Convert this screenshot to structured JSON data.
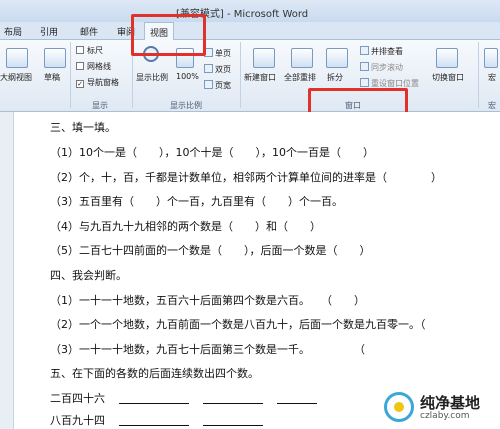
{
  "window": {
    "title": "[兼容模式] - Microsoft Word"
  },
  "tabs": [
    "布局",
    "引用",
    "邮件",
    "审阅",
    "视图"
  ],
  "active_tab": "视图",
  "ribbon": {
    "views": {
      "outline": "大纲视图",
      "draft": "草稿"
    },
    "show": {
      "ruler": "标尺",
      "gridlines": "网格线",
      "nav_pane": "导航窗格",
      "nav_pane_checked": true,
      "label": "显示"
    },
    "zoom": {
      "zoom": "显示比例",
      "percent": "100%",
      "one_page": "单页",
      "two_pages": "双页",
      "page_width": "页宽",
      "label": "显示比例"
    },
    "window": {
      "new_window": "新建窗口",
      "arrange_all": "全部重排",
      "split": "拆分",
      "side_by_side": "并排查看",
      "sync_scroll": "同步滚动",
      "reset_pos": "重设窗口位置",
      "switch": "切换窗口",
      "label": "窗口"
    },
    "macros": {
      "label": "宏",
      "btn": "宏"
    }
  },
  "document": {
    "lines": [
      "三、填一填。",
      "（1）10个一是（　　），10个十是（　　），10个一百是（　　）",
      "（2）个，十，百，千都是计数单位，相邻两个计算单位间的进率是（　　　　）",
      "（3）五百里有（　　）个一百，九百里有（　　）个一百。",
      "（4）与九百九十九相邻的两个数是（　　）和（　　）",
      "（5）二百七十四前面的一个数是（　　），后面一个数是（　　）",
      "四、我会判断。",
      "（1）一十一十地数，五百六十后面第四个数是六百。　　（　　）",
      "（2）一个一个地数，九百前面一个数是八百九十，后面一个数是九百零一。（",
      "（3）一十一十地数，九百七十后面第三个数是一千。　　　　　（",
      "五、在下面的各数的后面连续数出四个数。",
      "二百四十六",
      "八百九十四"
    ]
  },
  "watermark": {
    "text": "纯净基地",
    "url": "czlaby.com"
  }
}
